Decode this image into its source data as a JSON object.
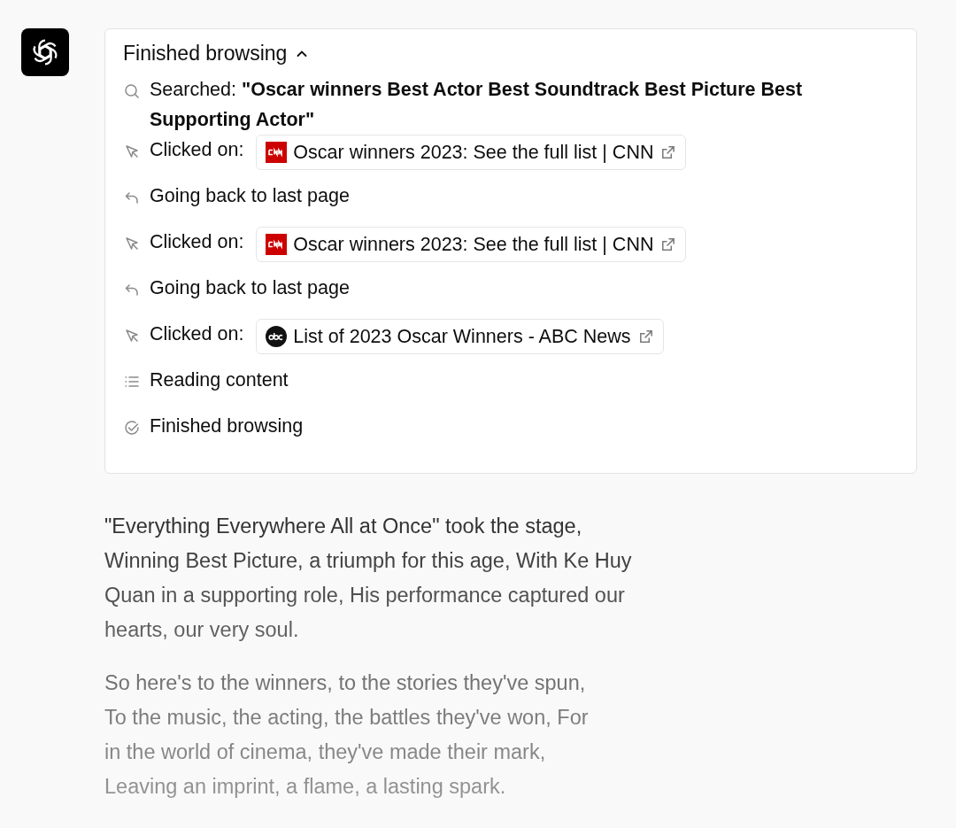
{
  "browsing": {
    "title": "Finished browsing",
    "expanded": true,
    "steps": [
      {
        "kind": "search",
        "label": "Searched:",
        "query": "\"Oscar winners Best Actor Best Soundtrack Best Picture Best Supporting Actor\""
      },
      {
        "kind": "click",
        "label": "Clicked on:",
        "link": {
          "kind": "cnn",
          "title": "Oscar winners 2023: See the full list | CNN"
        }
      },
      {
        "kind": "back",
        "label": "Going back to last page"
      },
      {
        "kind": "click",
        "label": "Clicked on:",
        "link": {
          "kind": "cnn",
          "title": "Oscar winners 2023: See the full list | CNN"
        }
      },
      {
        "kind": "back",
        "label": "Going back to last page"
      },
      {
        "kind": "click",
        "label": "Clicked on:",
        "link": {
          "kind": "abc",
          "title": "List of 2023 Oscar Winners - ABC News"
        }
      },
      {
        "kind": "read",
        "label": "Reading content"
      },
      {
        "kind": "done",
        "label": "Finished browsing"
      }
    ]
  },
  "paragraphs": [
    {
      "lines": [
        "\"Everything Everywhere All at Once\" took the stage,",
        "Winning Best Picture, a triumph for this age, With Ke Huy",
        "Quan in a supporting role, His performance captured our",
        "hearts, our very soul."
      ]
    },
    {
      "lines": [
        "So here's to the winners, to the stories they've spun,",
        "To the music, the acting, the battles they've won, For",
        "in the world of cinema, they've made their mark,",
        "Leaving an imprint, a flame, a lasting spark."
      ]
    }
  ]
}
